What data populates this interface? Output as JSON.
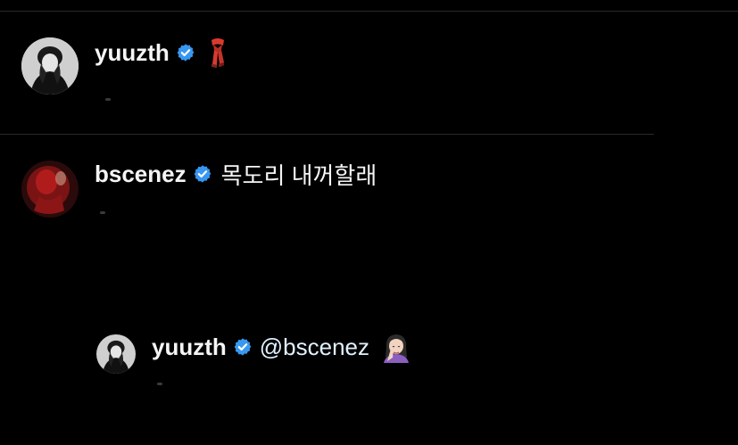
{
  "comments": [
    {
      "username": "yuuzth",
      "verified": true,
      "text": "",
      "emoji_icon": "scarf-icon"
    },
    {
      "username": "bscenez",
      "verified": true,
      "text": "목도리 내꺼할래"
    }
  ],
  "reply": {
    "username": "yuuzth",
    "verified": true,
    "mention": "@bscenez",
    "emoji_icon": "woman-facepalming-icon"
  },
  "colors": {
    "background": "#000000",
    "verified_badge": "#3897f0",
    "divider": "#2a2a2a"
  }
}
